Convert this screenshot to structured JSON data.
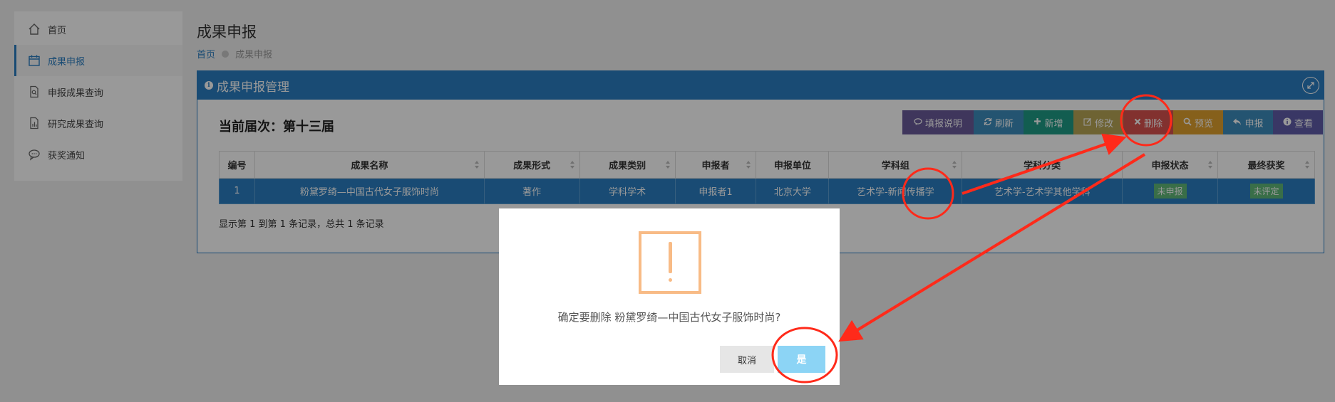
{
  "sidebar": {
    "items": [
      {
        "label": "首页",
        "icon": "home-icon"
      },
      {
        "label": "成果申报",
        "icon": "calendar-icon"
      },
      {
        "label": "申报成果查询",
        "icon": "document-search-icon"
      },
      {
        "label": "研究成果查询",
        "icon": "document-chart-icon"
      },
      {
        "label": "获奖通知",
        "icon": "chat-bubble-icon"
      }
    ],
    "active_index": 1
  },
  "header": {
    "title": "成果申报",
    "breadcrumb": {
      "home": "首页",
      "current": "成果申报"
    }
  },
  "panel": {
    "title": "成果申报管理",
    "round_label": "当前届次：第十三届",
    "toolbar": [
      {
        "label": "填报说明",
        "icon": "comment-icon",
        "color": "#6a5b9a"
      },
      {
        "label": "刷新",
        "icon": "refresh-icon",
        "color": "#3c8dbc"
      },
      {
        "label": "新增",
        "icon": "plus-icon",
        "color": "#1f9c85"
      },
      {
        "label": "修改",
        "icon": "edit-icon",
        "color": "#b7a656"
      },
      {
        "label": "删除",
        "icon": "close-icon",
        "color": "#d9534f"
      },
      {
        "label": "预览",
        "icon": "search-icon",
        "color": "#e0a12d"
      },
      {
        "label": "申报",
        "icon": "reply-icon",
        "color": "#3c8dbc"
      },
      {
        "label": "查看",
        "icon": "info-icon",
        "color": "#605ca8"
      }
    ],
    "table": {
      "columns": [
        "编号",
        "成果名称",
        "成果形式",
        "成果类别",
        "申报者",
        "申报单位",
        "学科组",
        "学科分类",
        "申报状态",
        "最终获奖"
      ],
      "rows": [
        [
          "1",
          "粉黛罗绮—中国古代女子服饰时尚",
          "著作",
          "学科学术",
          "申报者1",
          "北京大学",
          "艺术学-新闻传播学",
          "艺术学-艺术学其他学科",
          "未申报",
          "未评定"
        ]
      ]
    },
    "record_info": "显示第 1 到第 1 条记录，总共 1 条记录"
  },
  "dialog": {
    "message": "确定要删除 粉黛罗绮—中国古代女子服饰时尚?",
    "cancel_label": "取消",
    "confirm_label": "是"
  },
  "colors": {
    "accent": "#2b7ec1",
    "warning": "#f8bb86",
    "confirm": "#8cd4f5",
    "annotation": "#ff2a1a"
  }
}
